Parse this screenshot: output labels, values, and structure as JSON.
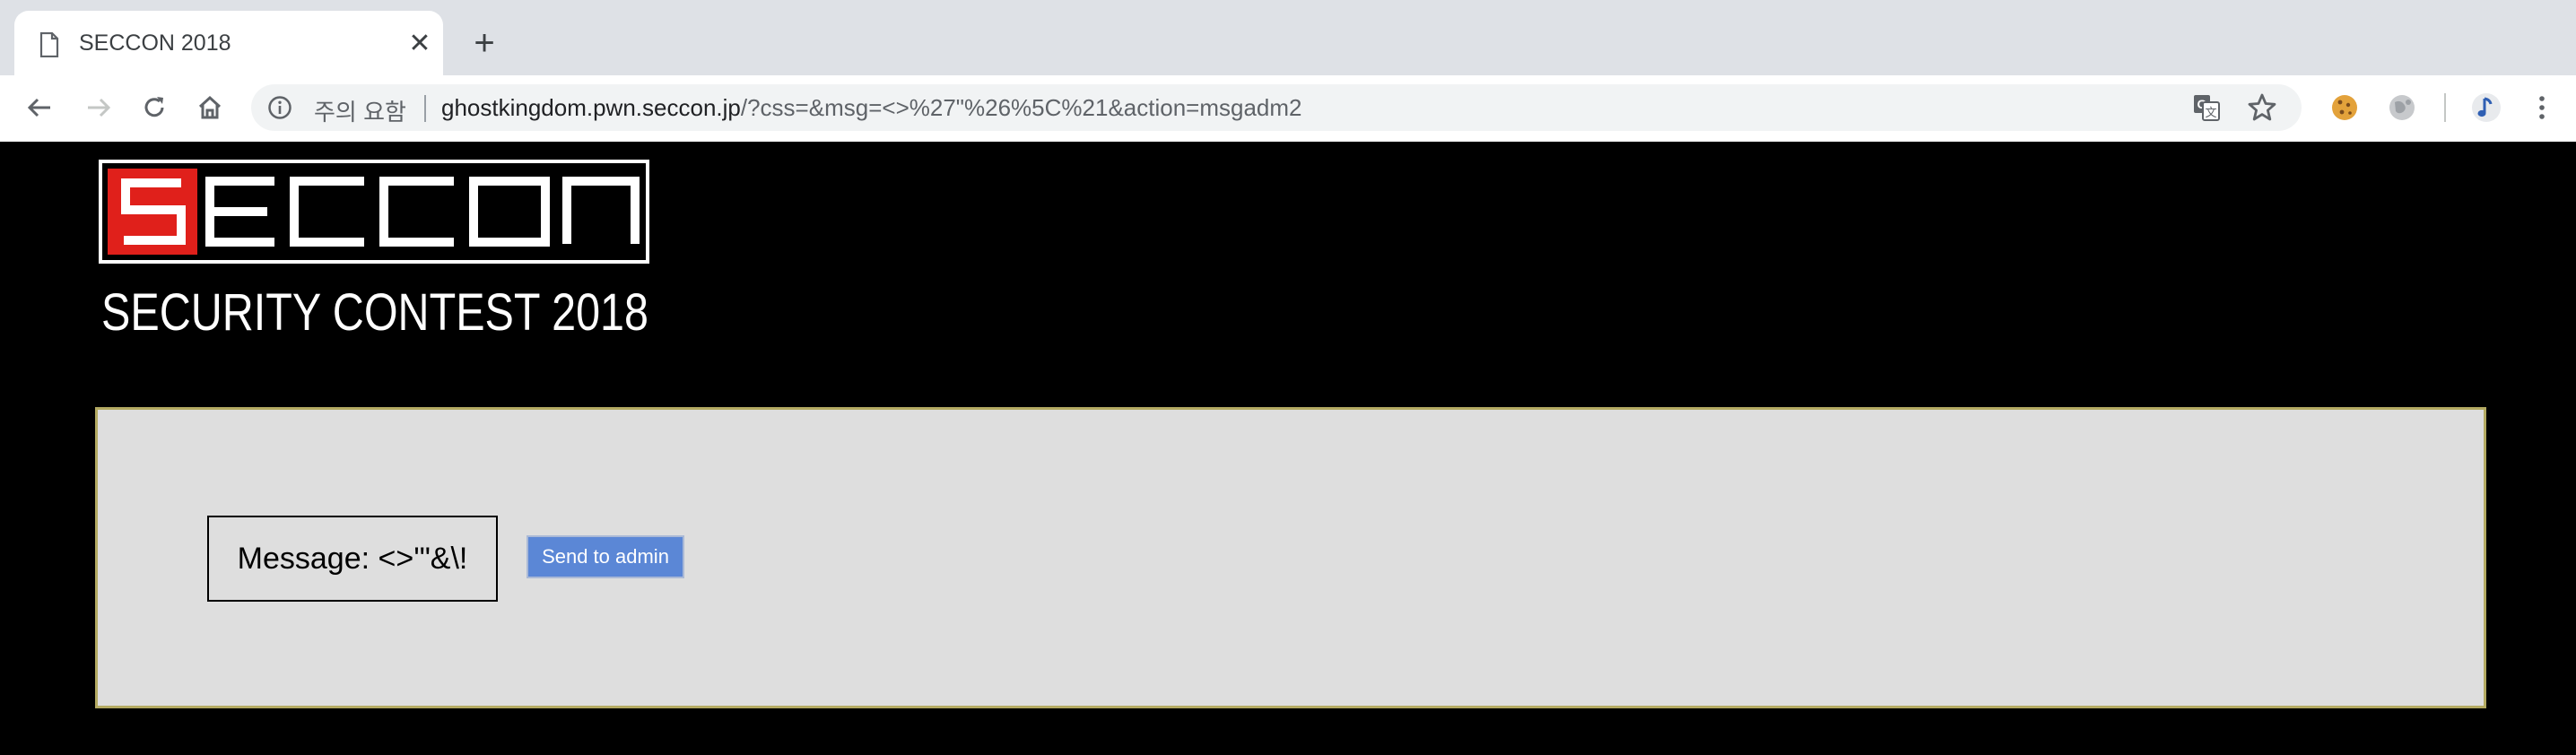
{
  "browser": {
    "tab": {
      "title": "SECCON 2018"
    },
    "omnibox": {
      "security_label": "주의 요함",
      "url_host": "ghostkingdom.pwn.seccon.jp",
      "url_path": "/?css=&msg=<>%27\"%26%5C%21&action=msgadm2"
    }
  },
  "page": {
    "logo": {
      "wordmark": "SECCON",
      "subtitle": "SECURITY CONTEST 2018"
    },
    "message_text": "Message: <>'\"&\\!",
    "send_button_label": "Send to admin"
  },
  "colors": {
    "logo_red": "#e0201b",
    "panel_bg": "#dedede",
    "panel_border": "#b4aa62",
    "button_bg": "#5b87d6"
  }
}
